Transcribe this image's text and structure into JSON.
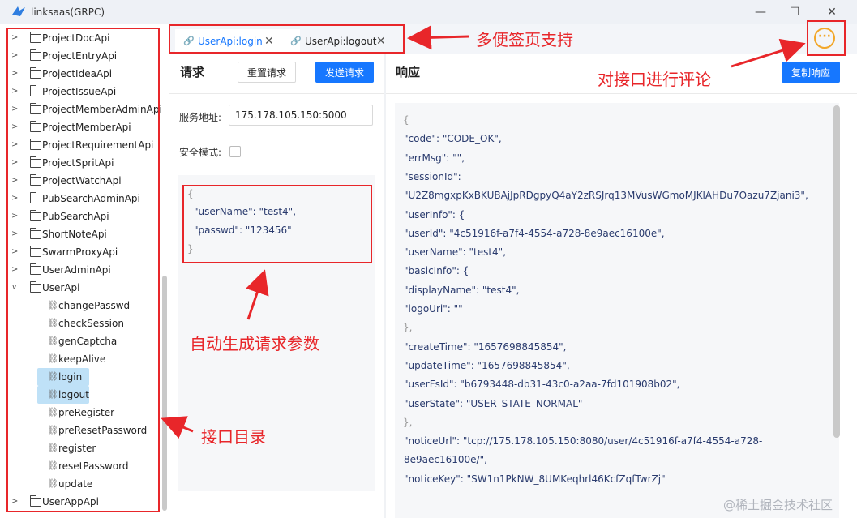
{
  "window": {
    "title": "linksaas(GRPC)",
    "minimize_glyph": "—",
    "maximize_glyph": "☐",
    "close_glyph": "✕"
  },
  "sidebar": {
    "folders_top": [
      "ProjectDocApi",
      "ProjectEntryApi",
      "ProjectIdeaApi",
      "ProjectIssueApi",
      "ProjectMemberAdminApi",
      "ProjectMemberApi",
      "ProjectRequirementApi",
      "ProjectSpritApi",
      "ProjectWatchApi",
      "PubSearchAdminApi",
      "PubSearchApi",
      "ShortNoteApi",
      "SwarmProxyApi",
      "UserAdminApi"
    ],
    "expanded_folder": "UserApi",
    "methods": [
      "changePasswd",
      "checkSession",
      "genCaptcha",
      "keepAlive",
      "login",
      "logout",
      "preRegister",
      "preResetPassword",
      "register",
      "resetPassword",
      "update"
    ],
    "selected_methods": [
      "login",
      "logout"
    ],
    "folders_bottom": [
      "UserAppApi"
    ]
  },
  "tabs": [
    {
      "label": "UserApi:login",
      "active": true
    },
    {
      "label": "UserApi:logout",
      "active": false
    }
  ],
  "comment_icon": "chat-bubble-icon",
  "request": {
    "title": "请求",
    "reset_label": "重置请求",
    "send_label": "发送请求",
    "server_label": "服务地址:",
    "server_value": "175.178.105.150:5000",
    "secure_label": "安全模式:",
    "secure_checked": false,
    "body_lines": [
      "{",
      "\"userName\": \"test4\",",
      "\"passwd\": \"123456\"",
      "}"
    ]
  },
  "response": {
    "title": "响应",
    "copy_label": "复制响应",
    "body_lines": [
      "{",
      "\"code\": \"CODE_OK\",",
      "\"errMsg\": \"\",",
      "\"sessionId\":",
      "\"U2Z8mgxpKxBKUBAjJpRDgpyQ4aY2zRSJrq13MVusWGmoMJKlAHDu7Oazu7Zjani3\",",
      "\"userInfo\": {",
      "\"userId\": \"4c51916f-a7f4-4554-a728-8e9aec16100e\",",
      "\"userName\": \"test4\",",
      "\"basicInfo\": {",
      "\"displayName\": \"test4\",",
      "\"logoUri\": \"\"",
      "},",
      "\"createTime\": \"1657698845854\",",
      "\"updateTime\": \"1657698845854\",",
      "\"userFsId\": \"b6793448-db31-43c0-a2aa-7fd101908b02\",",
      "\"userState\": \"USER_STATE_NORMAL\"",
      "},",
      "\"noticeUrl\": \"tcp://175.178.105.150:8080/user/4c51916f-a7f4-4554-a728-",
      "8e9aec16100e/\",",
      "\"noticeKey\": \"SW1n1PkNW_8UMKeqhrl46KcfZqfTwrZj\""
    ]
  },
  "annotations": {
    "tabs": "多便签页支持",
    "comment": "对接口进行评论",
    "params": "自动生成请求参数",
    "catalog": "接口目录"
  },
  "watermark": "@稀土掘金技术社区",
  "colors": {
    "accent": "#1677ff",
    "annotation": "#e8262a",
    "selection": "#bfe1f7",
    "comment": "#f2a72a"
  }
}
